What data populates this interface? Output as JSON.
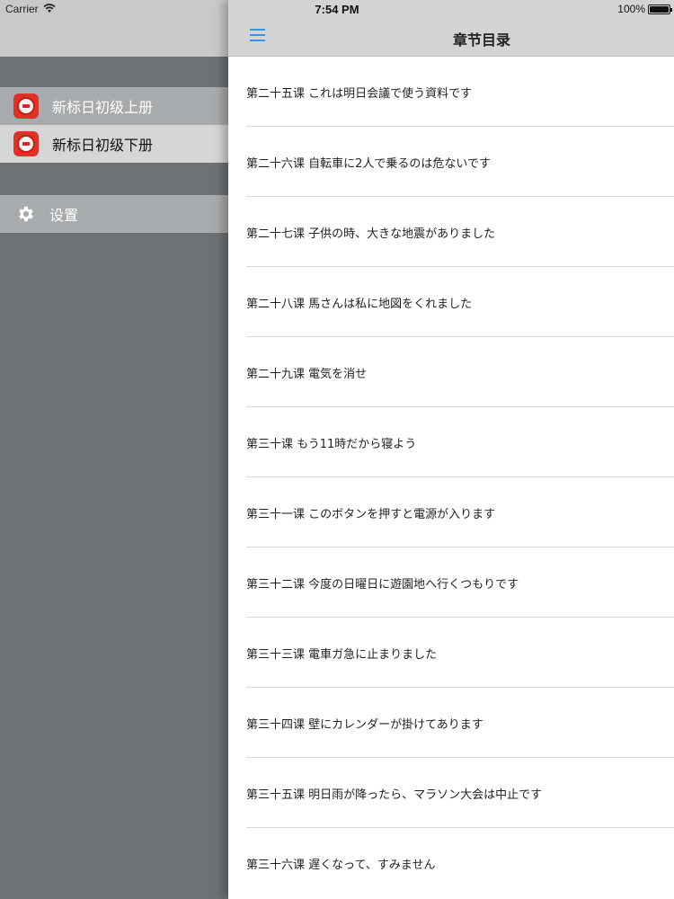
{
  "status_bar": {
    "carrier": "Carrier",
    "time": "7:54 PM",
    "battery": "100%"
  },
  "sidebar": {
    "items": [
      {
        "label": "新标日初级上册",
        "icon": "book-icon"
      },
      {
        "label": "新标日初级下册",
        "icon": "book-icon"
      }
    ],
    "settings_label": "设置"
  },
  "header": {
    "title": "章节目录"
  },
  "chapters": [
    "第二十五课 これは明日会議で使う資料です",
    "第二十六课 自転車に2人で乗るのは危ないです",
    "第二十七课 子供の時、大きな地震がありました",
    "第二十八课 馬さんは私に地図をくれました",
    "第二十九课 電気を消せ",
    "第三十课 もう11時だから寝よう",
    "第三十一课 このボタンを押すと電源が入ります",
    "第三十二课 今度の日曜日に遊園地へ行くつもりです",
    "第三十三课 電車ガ急に止まりました",
    "第三十四课 壁にカレンダーが掛けてあります",
    "第三十五课 明日雨が降ったら、マラソン大会は中止です",
    "第三十六课 遅くなって、すみません"
  ],
  "colors": {
    "accent": "#3d8fe0",
    "book_icon": "#e03127"
  }
}
